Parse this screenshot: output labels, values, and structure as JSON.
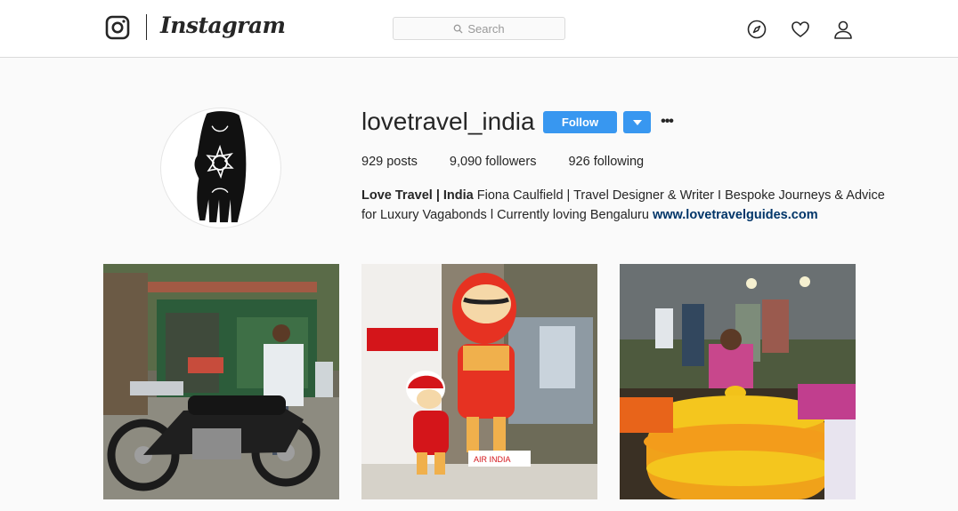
{
  "app": {
    "name": "Instagram"
  },
  "search": {
    "placeholder": "Search"
  },
  "nav": {
    "icons": [
      "compass-icon",
      "heart-icon",
      "person-icon"
    ]
  },
  "profile": {
    "username": "lovetravel_india",
    "follow_label": "Follow",
    "more_label": "•••",
    "stats": {
      "posts_count": "929",
      "posts_label": "posts",
      "followers_count": "9,090",
      "followers_label": "followers",
      "following_count": "926",
      "following_label": "following"
    },
    "bio": {
      "name": "Love Travel | India",
      "text": "Fiona Caulfield | Travel Designer & Writer I Bespoke Journeys & Advice for Luxury Vagabonds l Currently loving Bengaluru",
      "link": "www.lovetravelguides.com"
    }
  },
  "posts": [
    {
      "label": "post-motorcycle"
    },
    {
      "label": "post-maharaja"
    },
    {
      "label": "post-flower-market"
    }
  ],
  "colors": {
    "accent": "#3897f0",
    "link": "#003569",
    "text": "#262626",
    "border": "#dbdbdb"
  }
}
